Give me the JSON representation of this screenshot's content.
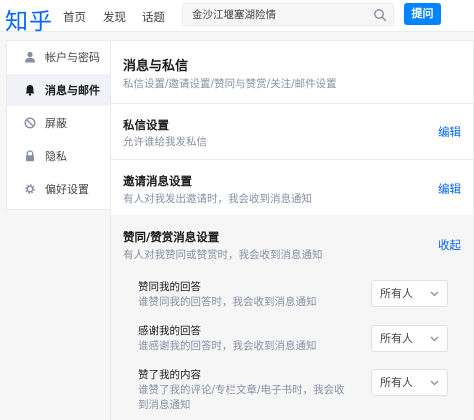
{
  "header": {
    "logo": "知乎",
    "nav": [
      "首页",
      "发现",
      "话题"
    ],
    "search_value": "金沙江堰塞湖险情",
    "ask_label": "提问"
  },
  "sidebar": {
    "items": [
      {
        "label": "帐户与密码",
        "icon": "user-icon"
      },
      {
        "label": "消息与邮件",
        "icon": "bell-icon"
      },
      {
        "label": "屏蔽",
        "icon": "block-icon"
      },
      {
        "label": "隐私",
        "icon": "lock-icon"
      },
      {
        "label": "偏好设置",
        "icon": "gear-icon"
      }
    ]
  },
  "main": {
    "title": "消息与私信",
    "subtitle": "私信设置/邀请设置/赞同与赞赏/关注/邮件设置",
    "sections": [
      {
        "title": "私信设置",
        "desc": "允许谁给我发私信",
        "action": "编辑"
      },
      {
        "title": "邀请消息设置",
        "desc": "有人对我发出邀请时，我会收到消息通知",
        "action": "编辑"
      },
      {
        "title": "赞同/赞赏消息设置",
        "desc": "有人对我赞同或赞赏时，我会收到消息通知",
        "action": "收起"
      }
    ],
    "subsettings": [
      {
        "title": "赞同我的回答",
        "desc": "谁赞同我的回答时，我会收到消息通知",
        "value": "所有人"
      },
      {
        "title": "感谢我的回答",
        "desc": "谁感谢我的回答时，我会收到消息通知",
        "value": "所有人"
      },
      {
        "title": "赞了我的内容",
        "desc": "谁赞了我的评论/专栏文章/电子书时，我会收到消息通知",
        "value": "所有人"
      }
    ]
  }
}
